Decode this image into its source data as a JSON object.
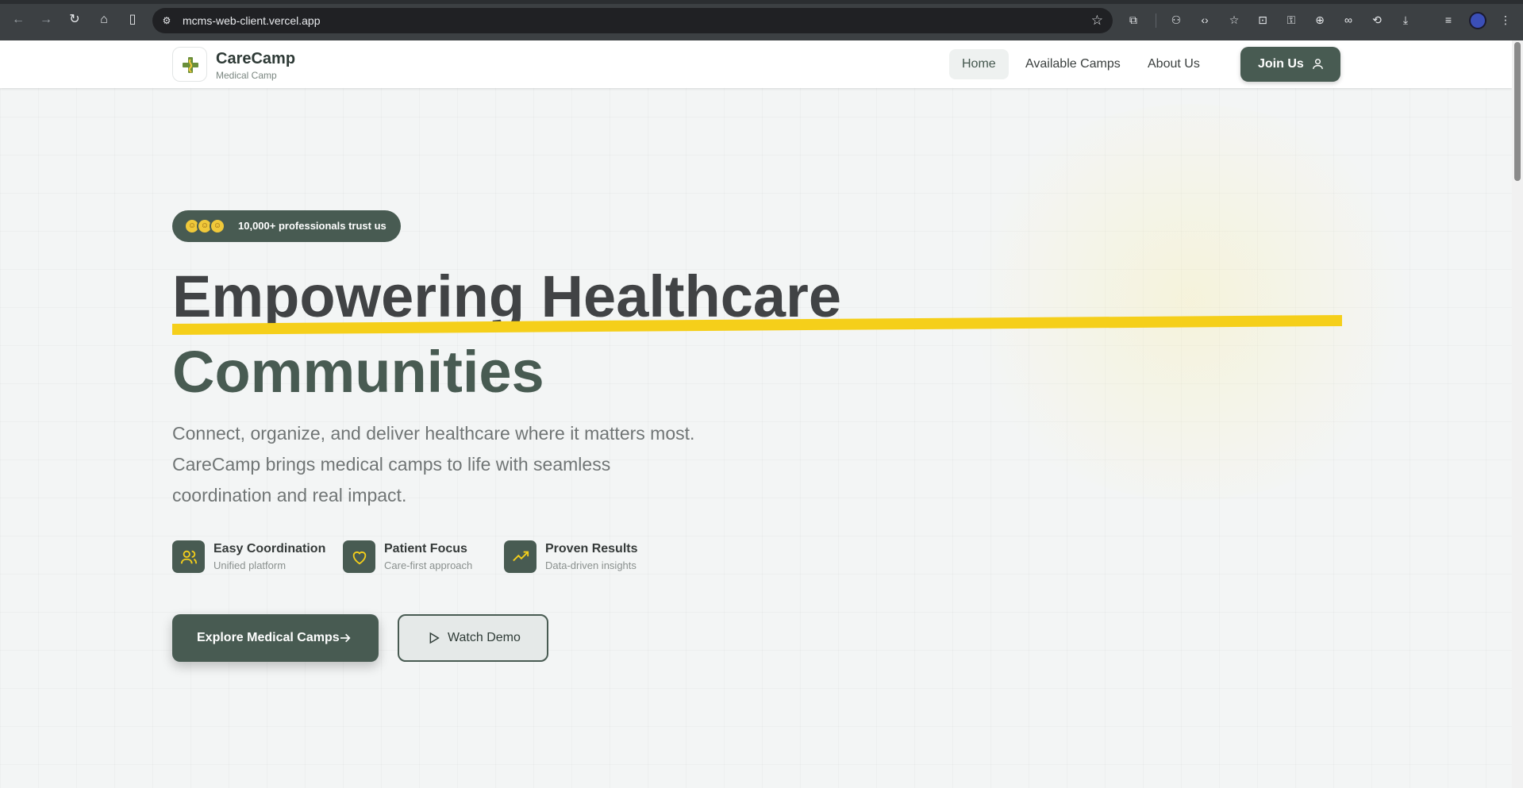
{
  "browser": {
    "url": "mcms-web-client.vercel.app",
    "icons": {
      "back": "arrow-left-icon",
      "forward": "arrow-right-icon",
      "reload": "reload-icon",
      "home": "home-icon",
      "sidebar": "side-panel-icon",
      "bookmark": "star-icon",
      "extensions": "puzzle-icon",
      "menu": "kebab-icon"
    }
  },
  "header": {
    "brand_name": "CareCamp",
    "brand_sub": "Medical Camp",
    "nav": [
      {
        "label": "Home",
        "active": true
      },
      {
        "label": "Available Camps",
        "active": false
      },
      {
        "label": "About Us",
        "active": false
      }
    ],
    "join_label": "Join Us"
  },
  "hero": {
    "trust_text": "10,000+ professionals trust us",
    "headline_line1": "Empowering Healthcare",
    "headline_line2": "Communities",
    "subtitle": "Connect, organize, and deliver healthcare where it matters most. CareCamp brings medical camps to life with seamless coordination and real impact.",
    "features": [
      {
        "title": "Easy Coordination",
        "sub": "Unified platform",
        "icon": "users-icon"
      },
      {
        "title": "Patient Focus",
        "sub": "Care-first approach",
        "icon": "heart-icon"
      },
      {
        "title": "Proven Results",
        "sub": "Data-driven insights",
        "icon": "trending-up-icon"
      }
    ],
    "primary_cta": "Explore Medical Camps",
    "secondary_cta": "Watch Demo"
  },
  "colors": {
    "primary": "#485b52",
    "accent": "#f5cf1a",
    "headline": "#414345",
    "background": "#f3f5f5"
  }
}
